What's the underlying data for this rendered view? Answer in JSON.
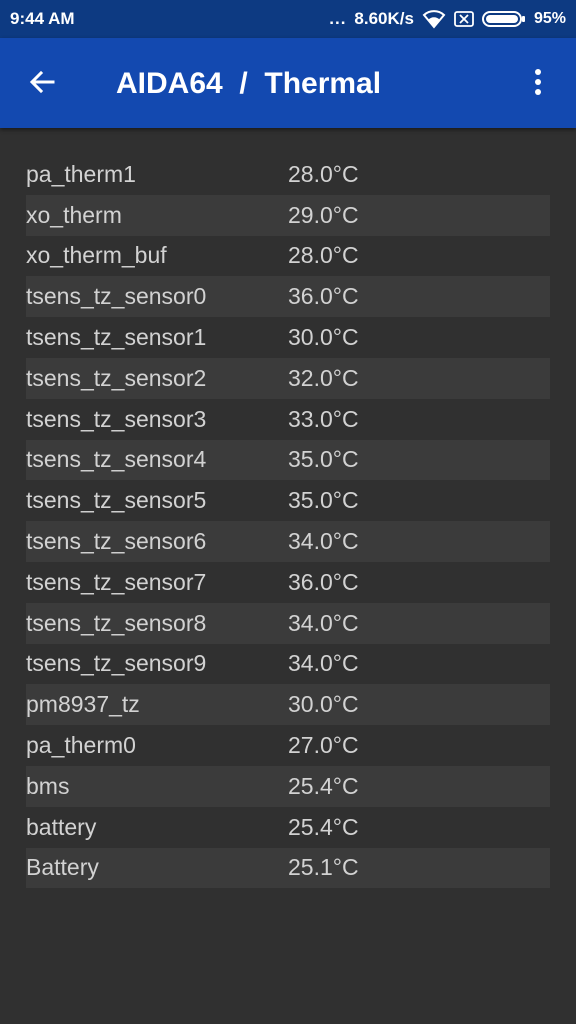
{
  "status_bar": {
    "time": "9:44 AM",
    "dots": "...",
    "speed": "8.60K/s",
    "battery_percent": "95%",
    "icons": [
      "wifi-icon",
      "sim-x-icon",
      "battery-icon"
    ]
  },
  "app_bar": {
    "title": "AIDA64  /  Thermal",
    "back_icon": "arrow-back-icon",
    "menu_icon": "overflow-menu-icon"
  },
  "sensors": [
    {
      "name": "pa_therm1",
      "value": "28.0°C"
    },
    {
      "name": "xo_therm",
      "value": "29.0°C"
    },
    {
      "name": "xo_therm_buf",
      "value": "28.0°C"
    },
    {
      "name": "tsens_tz_sensor0",
      "value": "36.0°C"
    },
    {
      "name": "tsens_tz_sensor1",
      "value": "30.0°C"
    },
    {
      "name": "tsens_tz_sensor2",
      "value": "32.0°C"
    },
    {
      "name": "tsens_tz_sensor3",
      "value": "33.0°C"
    },
    {
      "name": "tsens_tz_sensor4",
      "value": "35.0°C"
    },
    {
      "name": "tsens_tz_sensor5",
      "value": "35.0°C"
    },
    {
      "name": "tsens_tz_sensor6",
      "value": "34.0°C"
    },
    {
      "name": "tsens_tz_sensor7",
      "value": "36.0°C"
    },
    {
      "name": "tsens_tz_sensor8",
      "value": "34.0°C"
    },
    {
      "name": "tsens_tz_sensor9",
      "value": "34.0°C"
    },
    {
      "name": "pm8937_tz",
      "value": "30.0°C"
    },
    {
      "name": "pa_therm0",
      "value": "27.0°C"
    },
    {
      "name": "bms",
      "value": "25.4°C"
    },
    {
      "name": "battery",
      "value": "25.4°C"
    },
    {
      "name": "Battery",
      "value": "25.1°C"
    }
  ],
  "colors": {
    "status_bar": "#0d3a82",
    "app_bar": "#1349b0",
    "background": "#303030",
    "row_alt": "#3b3b3b",
    "text": "#d2d2d2"
  }
}
